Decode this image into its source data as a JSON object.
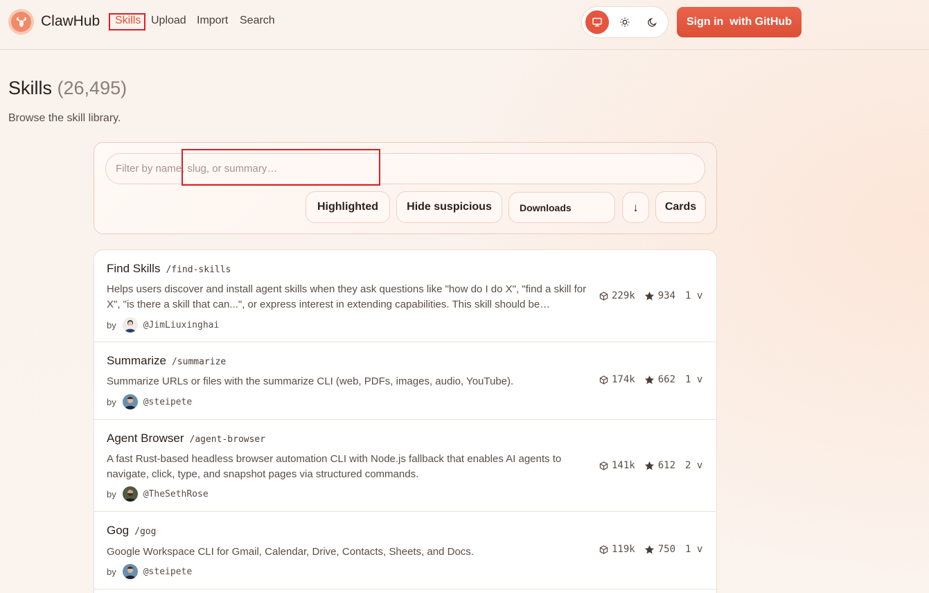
{
  "header": {
    "brand": "ClawHub",
    "nav": [
      "Skills",
      "Upload",
      "Import",
      "Search"
    ],
    "signin_label": "Sign in  with GitHub"
  },
  "page": {
    "title": "Skills",
    "count": "(26,495)",
    "subtitle": "Browse the skill library."
  },
  "filters": {
    "search_placeholder": "Filter by name, slug, or summary…",
    "highlighted_label": "Highlighted",
    "hide_suspicious_label": "Hide suspicious",
    "sort_value": "Downloads",
    "direction_label": "↓",
    "view_label": "Cards"
  },
  "skills": [
    {
      "name": "Find Skills",
      "slug": "/find-skills",
      "description": "Helps users discover and install agent skills when they ask questions like \"how do I do X\", \"find a skill for X\", \"is there a skill that can...\", or express interest in extending capabilities. This skill should be…",
      "by": "by",
      "author": "@JimLiuxinghai",
      "downloads": "229k",
      "stars": "934",
      "versions": "1 v"
    },
    {
      "name": "Summarize",
      "slug": "/summarize",
      "description": "Summarize URLs or files with the summarize CLI (web, PDFs, images, audio, YouTube).",
      "by": "by",
      "author": "@steipete",
      "downloads": "174k",
      "stars": "662",
      "versions": "1 v"
    },
    {
      "name": "Agent Browser",
      "slug": "/agent-browser",
      "description": "A fast Rust-based headless browser automation CLI with Node.js fallback that enables AI agents to navigate, click, type, and snapshot pages via structured commands.",
      "by": "by",
      "author": "@TheSethRose",
      "downloads": "141k",
      "stars": "612",
      "versions": "2 v"
    },
    {
      "name": "Gog",
      "slug": "/gog",
      "description": "Google Workspace CLI for Gmail, Calendar, Drive, Contacts, Sheets, and Docs.",
      "by": "by",
      "author": "@steipete",
      "downloads": "119k",
      "stars": "750",
      "versions": "1 v"
    }
  ],
  "colors": {
    "accent": "#e6553f",
    "highlight_box": "#e01e22",
    "background": "#faf2ec"
  }
}
